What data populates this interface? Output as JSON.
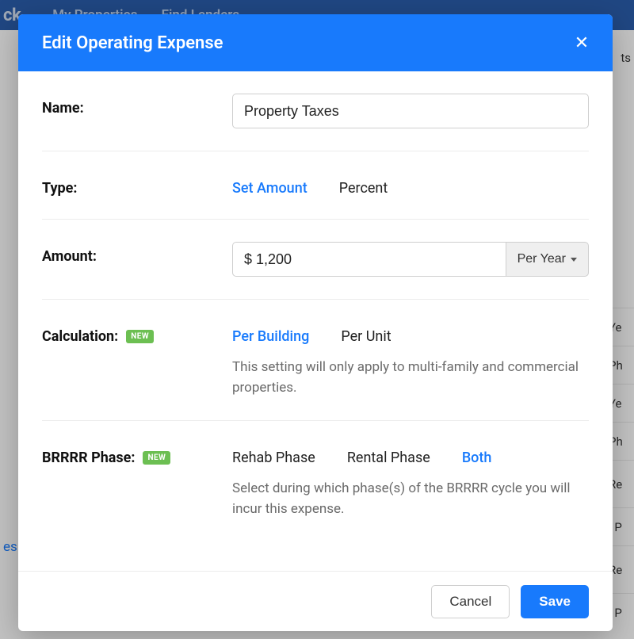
{
  "background": {
    "brand_fragment": "ck",
    "nav": [
      "My Properties",
      "Find Lenders"
    ],
    "side_fragment": "es",
    "right_fragment": "ts",
    "row_fragments": [
      "Ye",
      "Ph",
      "Ye",
      "Ph",
      "Re",
      "l P",
      "Re",
      "l P"
    ]
  },
  "modal": {
    "title": "Edit Operating Expense",
    "close_glyph": "✕",
    "name": {
      "label": "Name:",
      "value": "Property Taxes"
    },
    "type": {
      "label": "Type:",
      "options": [
        "Set Amount",
        "Percent"
      ],
      "selected": "Set Amount"
    },
    "amount": {
      "label": "Amount:",
      "value": "$ 1,200",
      "period_label": "Per Year"
    },
    "calculation": {
      "label": "Calculation:",
      "badge": "NEW",
      "options": [
        "Per Building",
        "Per Unit"
      ],
      "selected": "Per Building",
      "help": "This setting will only apply to multi-family and commercial properties."
    },
    "brrrr": {
      "label": "BRRRR Phase:",
      "badge": "NEW",
      "options": [
        "Rehab Phase",
        "Rental Phase",
        "Both"
      ],
      "selected": "Both",
      "help": "Select during which phase(s) of the BRRRR cycle you will incur this expense."
    },
    "footer": {
      "cancel": "Cancel",
      "save": "Save"
    }
  }
}
